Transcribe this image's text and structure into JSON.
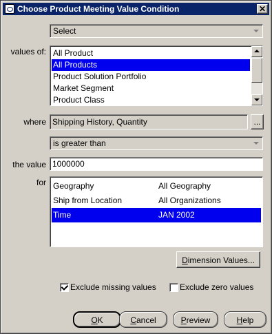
{
  "window": {
    "title": "Choose Product Meeting Value Condition",
    "close_glyph": "✕"
  },
  "select_combo": {
    "value": "Select"
  },
  "values_of": {
    "label": "values of:",
    "items": [
      "All Product",
      "All Products",
      "Product Solution Portfolio",
      "Market Segment",
      "Product Class"
    ],
    "selected_index": 1
  },
  "where": {
    "label": "where",
    "value": "Shipping History, Quantity",
    "browse_label": "..."
  },
  "operator": {
    "value": "is greater than"
  },
  "the_value": {
    "label": "the value",
    "value": "1000000"
  },
  "for": {
    "label": "for",
    "rows": [
      {
        "dimension": "Geography",
        "value": "All Geography"
      },
      {
        "dimension": "Ship from Location",
        "value": "All Organizations"
      },
      {
        "dimension": "Time",
        "value": "JAN 2002"
      }
    ],
    "selected_index": 2
  },
  "dimension_values_button": {
    "prefix": "",
    "mnemonic": "D",
    "rest": "imension Values..."
  },
  "options": {
    "exclude_missing": {
      "label": "Exclude missing values",
      "checked": true
    },
    "exclude_zero": {
      "label": "Exclude zero values",
      "checked": false
    }
  },
  "buttons": {
    "ok": {
      "mnemonic": "O",
      "rest": "K"
    },
    "cancel": {
      "mnemonic": "C",
      "rest": "ancel"
    },
    "preview": {
      "mnemonic": "P",
      "rest": "review"
    },
    "help": {
      "mnemonic": "H",
      "rest": "elp"
    }
  },
  "colors": {
    "selection": "#0000ee",
    "titlebar": "#0a246a",
    "face": "#d4d0c8"
  }
}
